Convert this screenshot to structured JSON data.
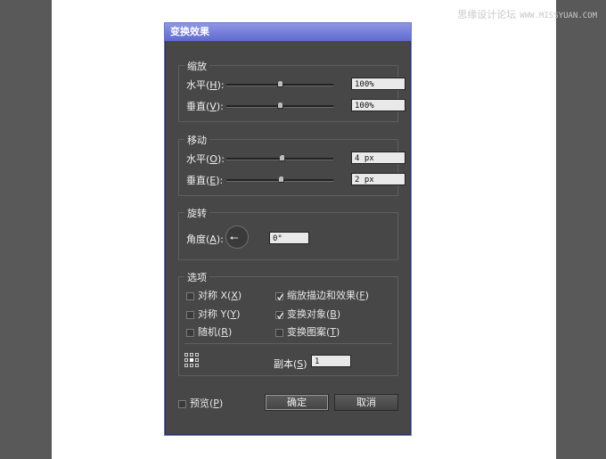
{
  "watermark": {
    "text": "思缘设计论坛",
    "url_text": "WWW.MISSYUAN.COM"
  },
  "dialog": {
    "title": "变换效果",
    "scale": {
      "title": "缩放",
      "horizontal": {
        "label": "水平(",
        "key": "H",
        "suffix": "):",
        "value": "100%",
        "slider_pos": 0.5
      },
      "vertical": {
        "label": "垂直(",
        "key": "V",
        "suffix": "):",
        "value": "100%",
        "slider_pos": 0.5
      }
    },
    "move": {
      "title": "移动",
      "horizontal": {
        "label": "水平(",
        "key": "O",
        "suffix": "):",
        "value": "4 px",
        "slider_pos": 0.52
      },
      "vertical": {
        "label": "垂直(",
        "key": "E",
        "suffix": "):",
        "value": "2 px",
        "slider_pos": 0.51
      }
    },
    "rotate": {
      "title": "旋转",
      "angle": {
        "label": "角度(",
        "key": "A",
        "suffix": "):",
        "value": "0°"
      }
    },
    "options": {
      "title": "选项",
      "reflect_x": {
        "label": "对称 X(",
        "key": "X",
        "suffix": ")",
        "checked": false
      },
      "reflect_y": {
        "label": "对称 Y(",
        "key": "Y",
        "suffix": ")",
        "checked": false
      },
      "random": {
        "label": "随机(",
        "key": "R",
        "suffix": ")",
        "checked": false
      },
      "scale_strokes": {
        "label": "缩放描边和效果(",
        "key": "F",
        "suffix": ")",
        "checked": true
      },
      "transform_objects": {
        "label": "变换对象(",
        "key": "B",
        "suffix": ")",
        "checked": true
      },
      "transform_patterns": {
        "label": "变换图案(",
        "key": "T",
        "suffix": ")",
        "checked": false
      },
      "copies": {
        "label": "副本(",
        "key": "S",
        "suffix": ")",
        "value": "1"
      }
    },
    "preview": {
      "label": "预览(",
      "key": "P",
      "suffix": ")",
      "checked": false
    },
    "ok_label": "确定",
    "cancel_label": "取消"
  }
}
